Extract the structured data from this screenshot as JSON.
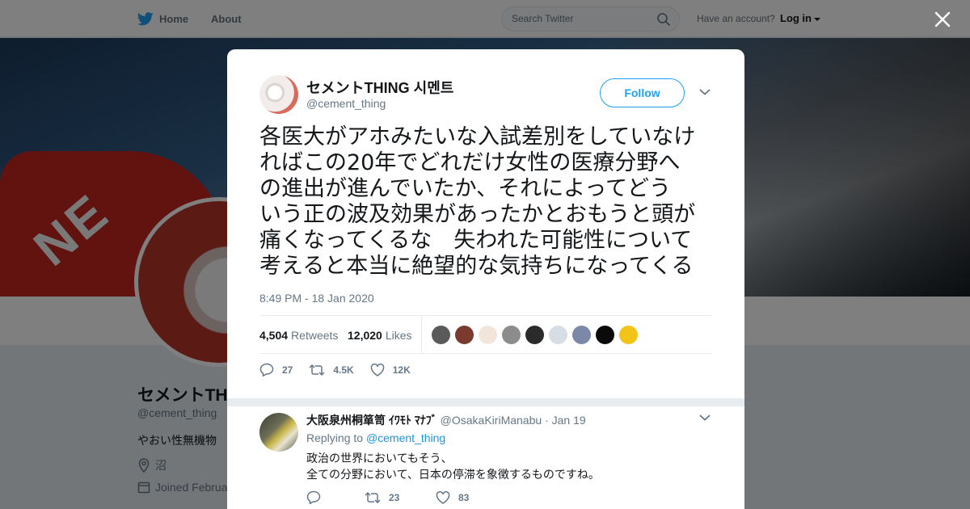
{
  "nav": {
    "home_label": "Home",
    "about_label": "About",
    "search_placeholder": "Search Twitter",
    "have_account": "Have an account?",
    "login_label": "Log in"
  },
  "background_profile": {
    "name": "セメントTHING 시멘트",
    "handle": "@cement_thing",
    "bio": "やおい性無機物",
    "location": "沼",
    "joined": "Joined February"
  },
  "tweet": {
    "author_name": "セメントTHING 시멘트",
    "author_handle": "@cement_thing",
    "follow_label": "Follow",
    "text_lines": [
      "各医大がアホみたいな入試差別をしていなけ",
      "ればこの20年でどれだけ女性の医療分野へ",
      "の進出が進んでいたか、それによってどう",
      "いう正の波及効果があったかとおもうと頭が",
      "痛くなってくるな　失われた可能性について",
      "考えると本当に絶望的な気持ちになってくる"
    ],
    "timestamp": "8:49 PM - 18 Jan 2020",
    "retweets_count": "4,504",
    "retweets_label": "Retweets",
    "likes_count": "12,020",
    "likes_label": "Likes",
    "reply_count": "27",
    "retweet_short": "4.5K",
    "like_short": "12K",
    "liker_colors": [
      "#5a5a5a",
      "#7a3b2e",
      "#f2e6dc",
      "#8c8c8c",
      "#2b2b2b",
      "#d7dde4",
      "#7b88a8",
      "#0a0a0a",
      "#f2c318"
    ]
  },
  "reply": {
    "name": "大阪泉州桐箪笥 ｲﾜﾓﾄ ﾏﾅﾌﾞ",
    "handle": "@OsakaKiriManabu",
    "separator": "·",
    "date": "Jan 19",
    "replying_prefix": "Replying to",
    "replying_to": "@cement_thing",
    "line1": "政治の世界においてもそう、",
    "line2": "全ての分野において、日本の停滞を象徴するものですね。",
    "reply_count": "",
    "retweet_count": "23",
    "like_count": "83"
  },
  "colors": {
    "twitter_blue": "#1da1f2",
    "link_blue": "#1b95e0",
    "muted_text": "#657786",
    "overlay": "rgba(0,0,0,0.5)"
  }
}
